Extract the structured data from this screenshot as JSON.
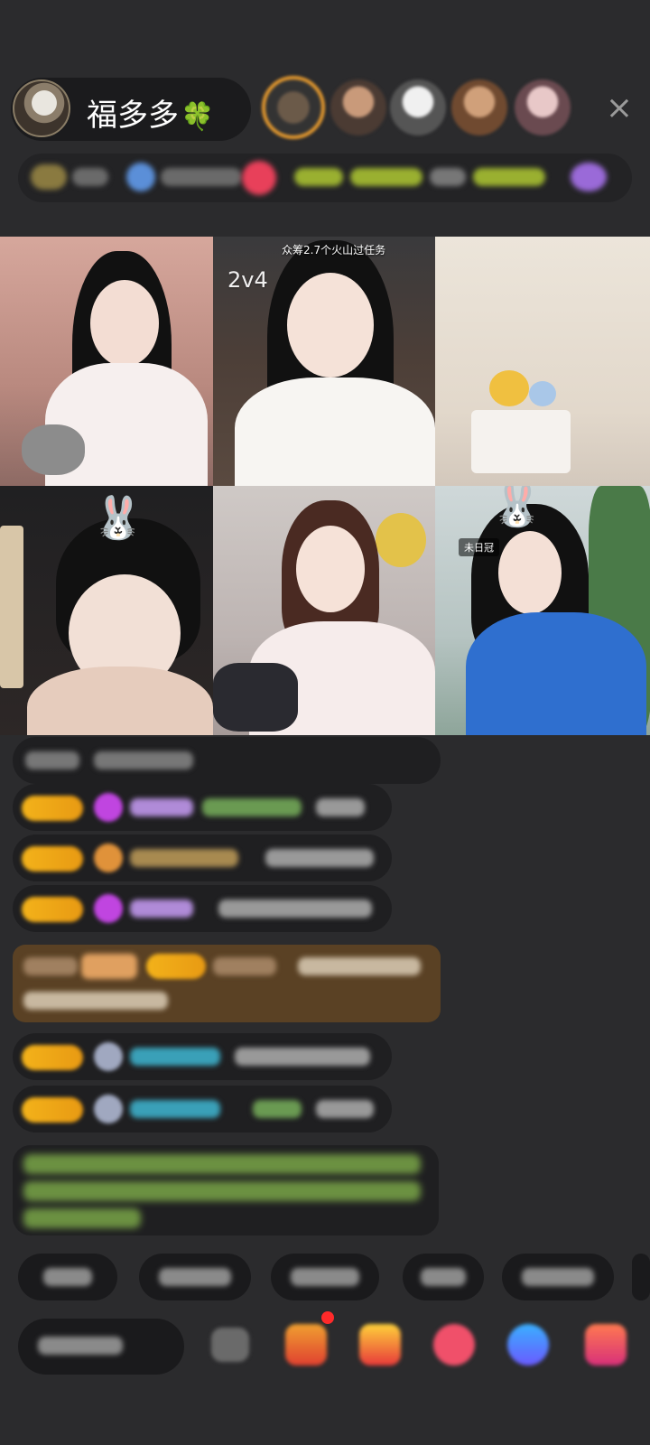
{
  "header": {
    "host_name": "福多多",
    "host_emoji": "🍀",
    "close_icon": "×"
  },
  "video_grid": {
    "tile2_label": "2v4",
    "tile2_task": "众筹2.7个火山过任务",
    "tile6_badge": "未日冠",
    "tile4_icon": "bunny-ears",
    "tile6_icon": "bunny-ears"
  },
  "colors": {
    "background": "#2b2b2d",
    "level_badge": "#f3b21a",
    "highlight_frame": "#e69a2e",
    "system_message": "#5a4124",
    "notice_text": "#7fae4a"
  }
}
